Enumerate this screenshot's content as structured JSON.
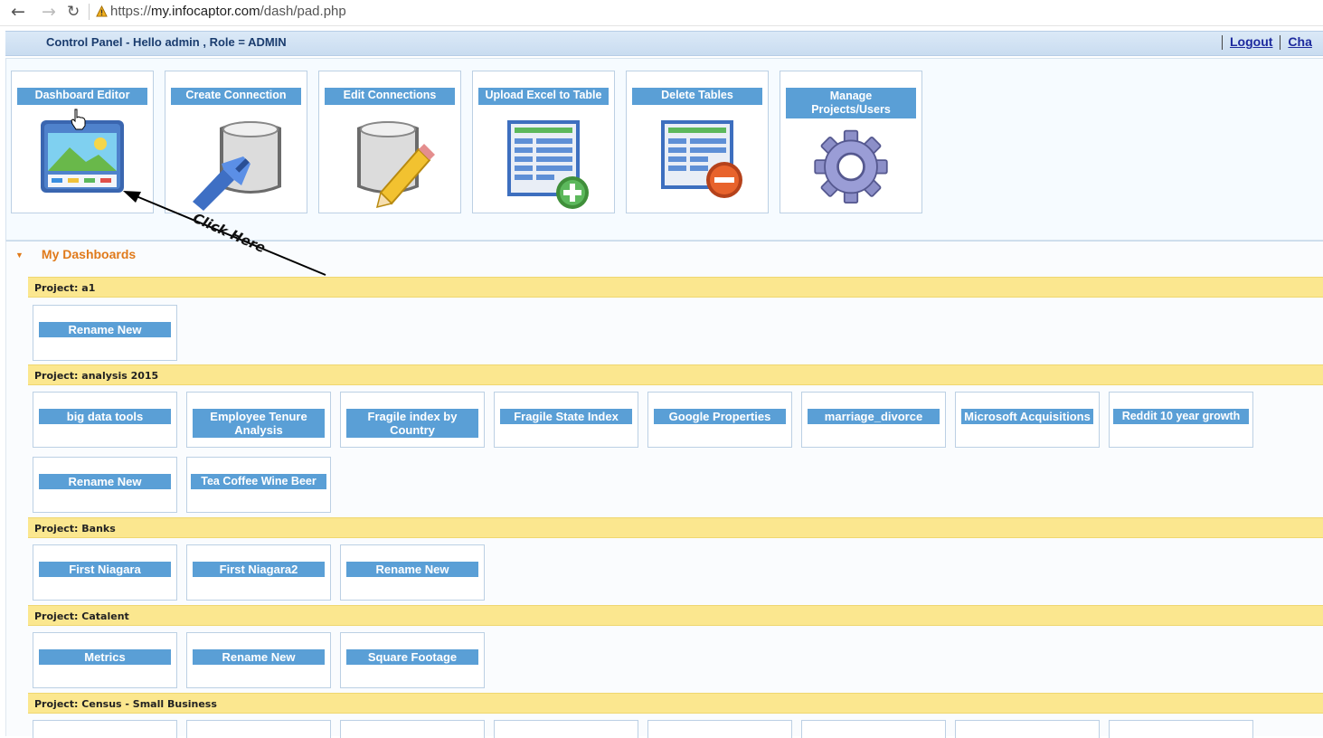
{
  "browser": {
    "url_prefix": "https://",
    "url_host": "my.infocaptor.com",
    "url_path": "/dash/pad.php"
  },
  "header": {
    "title": "Control Panel - Hello admin ,   Role = ADMIN",
    "logout_label": "Logout",
    "change_label": "Cha"
  },
  "tools": [
    {
      "label": "Dashboard Editor",
      "icon": "dashboard-editor-icon"
    },
    {
      "label": "Create Connection",
      "icon": "create-connection-icon"
    },
    {
      "label": "Edit Connections",
      "icon": "edit-connections-icon"
    },
    {
      "label": "Upload Excel to Table",
      "icon": "upload-excel-icon"
    },
    {
      "label": "Delete Tables",
      "icon": "delete-tables-icon"
    },
    {
      "label": "Manage Projects/Users",
      "icon": "gear-icon"
    }
  ],
  "annotation": {
    "text": "Click Here"
  },
  "dashboards": {
    "section_title": "My Dashboards",
    "projects": [
      {
        "name": "Project: a1",
        "items": [
          "Rename New"
        ]
      },
      {
        "name": "Project: analysis 2015",
        "items": [
          "big data tools",
          "Employee Tenure Analysis",
          "Fragile index by Country",
          "Fragile State Index",
          "Google Properties",
          "marriage_divorce",
          "Microsoft Acquisitions",
          "Reddit 10 year growth",
          "Rename New",
          "Tea Coffee Wine Beer"
        ]
      },
      {
        "name": "Project: Banks",
        "items": [
          "First Niagara",
          "First Niagara2",
          "Rename New"
        ]
      },
      {
        "name": "Project: Catalent",
        "items": [
          "Metrics",
          "Rename New",
          "Square Footage"
        ]
      },
      {
        "name": "Project: Census - Small Business",
        "items": []
      }
    ]
  },
  "colors": {
    "label_blue": "#5a9fd6",
    "project_yellow": "#fbe78f",
    "section_orange": "#e07a1a"
  }
}
